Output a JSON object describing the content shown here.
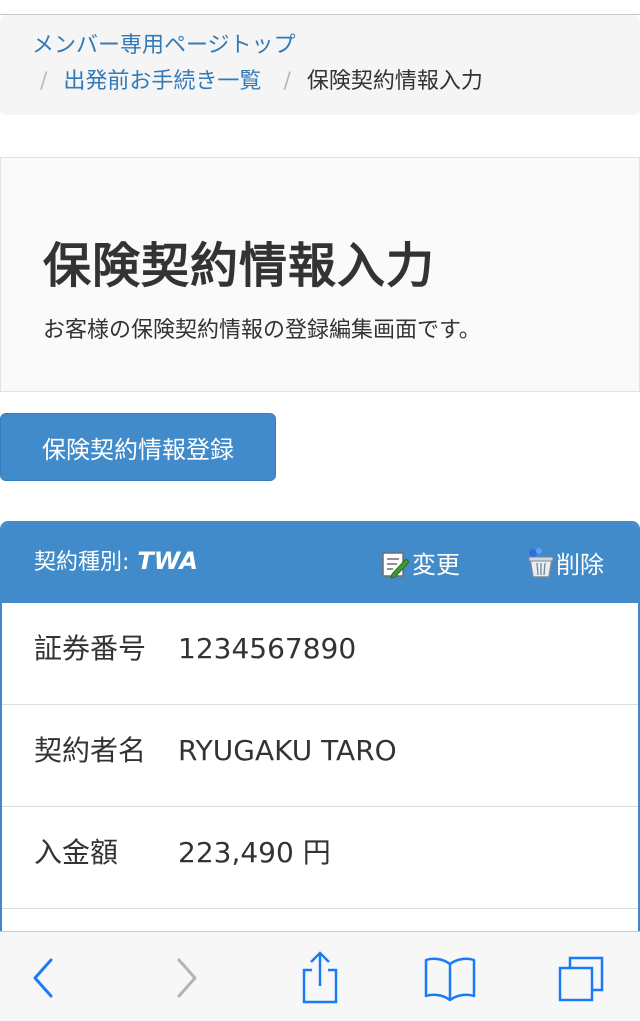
{
  "breadcrumb": {
    "items": [
      {
        "label": "メンバー専用ページトップ"
      },
      {
        "label": "出発前お手続き一覧"
      },
      {
        "label": "保険契約情報入力"
      }
    ],
    "separator": "/"
  },
  "header": {
    "title": "保険契約情報入力",
    "description": "お客様の保険契約情報の登録編集画面です。"
  },
  "actions": {
    "register_label": "保険契約情報登録"
  },
  "contract": {
    "type_label": "契約種別:",
    "type_value": "TWA",
    "edit_label": "変更",
    "delete_label": "削除",
    "fields": [
      {
        "label": "証券番号",
        "value": "1234567890"
      },
      {
        "label": "契約者名",
        "value": "RYUGAKU TARO"
      },
      {
        "label": "入金額",
        "value": "223,490 円"
      }
    ]
  },
  "toolbar": {
    "icons": [
      "back-icon",
      "forward-icon",
      "share-icon",
      "bookmarks-icon",
      "tabs-icon"
    ]
  },
  "colors": {
    "primary": "#428bca",
    "link": "#337ab7",
    "toolbar_icon": "#1a7cf5",
    "toolbar_disabled": "#b4b4b4"
  }
}
